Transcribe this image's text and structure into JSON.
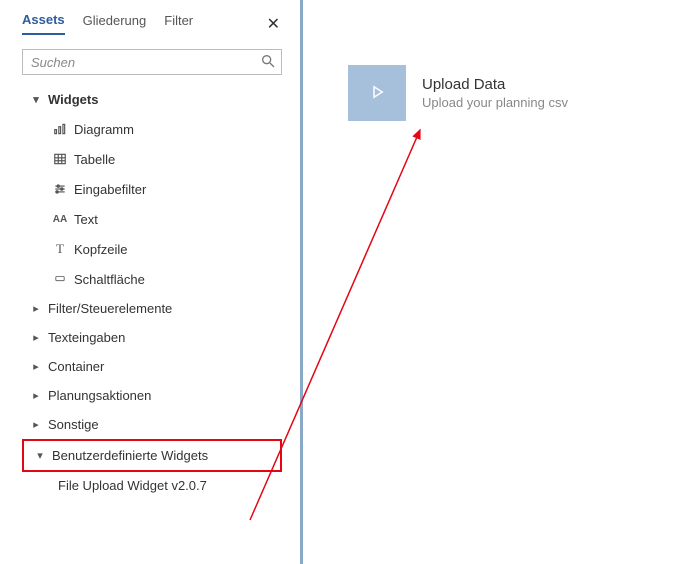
{
  "tabs": {
    "assets": "Assets",
    "outline": "Gliederung",
    "filter": "Filter"
  },
  "search": {
    "placeholder": "Suchen"
  },
  "tree": {
    "widgets_label": "Widgets",
    "items": [
      {
        "label": "Diagramm"
      },
      {
        "label": "Tabelle"
      },
      {
        "label": "Eingabefilter"
      },
      {
        "label": "Text"
      },
      {
        "label": "Kopfzeile"
      },
      {
        "label": "Schaltfläche"
      }
    ],
    "groups": [
      {
        "label": "Filter/Steuerelemente"
      },
      {
        "label": "Texteingaben"
      },
      {
        "label": "Container"
      },
      {
        "label": "Planungsaktionen"
      },
      {
        "label": "Sonstige"
      }
    ],
    "custom_label": "Benutzerdefinierte Widgets",
    "custom_child": "File Upload Widget v2.0.7"
  },
  "widget": {
    "title": "Upload Data",
    "subtitle": "Upload your planning csv"
  }
}
